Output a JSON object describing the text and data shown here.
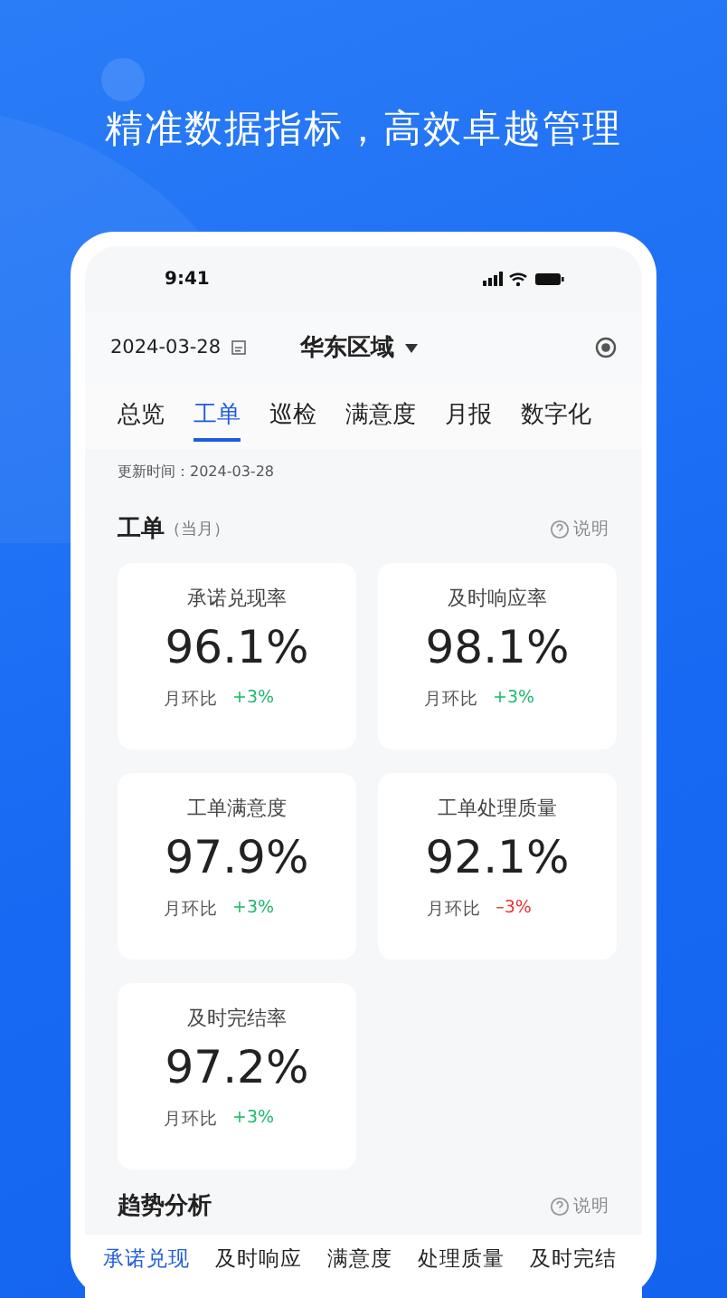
{
  "headline": "精准数据指标，高效卓越管理",
  "status_bar": {
    "time": "9:41"
  },
  "header": {
    "date": "2024-03-28",
    "region": "华东区域"
  },
  "tabs": [
    {
      "label": "总览",
      "selected": false
    },
    {
      "label": "工单",
      "selected": true
    },
    {
      "label": "巡检",
      "selected": false
    },
    {
      "label": "满意度",
      "selected": false
    },
    {
      "label": "月报",
      "selected": false
    },
    {
      "label": "数字化",
      "selected": false
    }
  ],
  "update_time": "更新时间：2024-03-28",
  "section": {
    "title": "工单",
    "subtitle": "（当月）",
    "help": "说明"
  },
  "metrics": [
    {
      "title": "承诺兑现率",
      "value": "96.1%",
      "compare_label": "月环比",
      "delta": "+3%",
      "kind": "up"
    },
    {
      "title": "及时响应率",
      "value": "98.1%",
      "compare_label": "月环比",
      "delta": "+3%",
      "kind": "up"
    },
    {
      "title": "工单满意度",
      "value": "97.9%",
      "compare_label": "月环比",
      "delta": "+3%",
      "kind": "up"
    },
    {
      "title": "工单处理质量",
      "value": "92.1%",
      "compare_label": "月环比",
      "delta": "–3%",
      "kind": "down"
    },
    {
      "title": "及时完结率",
      "value": "97.2%",
      "compare_label": "月环比",
      "delta": "+3%",
      "kind": "up"
    }
  ],
  "trend": {
    "title": "趋势分析",
    "help": "说明",
    "tabs": [
      {
        "label": "承诺兑现",
        "selected": true
      },
      {
        "label": "及时响应",
        "selected": false
      },
      {
        "label": "满意度",
        "selected": false
      },
      {
        "label": "处理质量",
        "selected": false
      },
      {
        "label": "及时完结",
        "selected": false
      }
    ]
  }
}
